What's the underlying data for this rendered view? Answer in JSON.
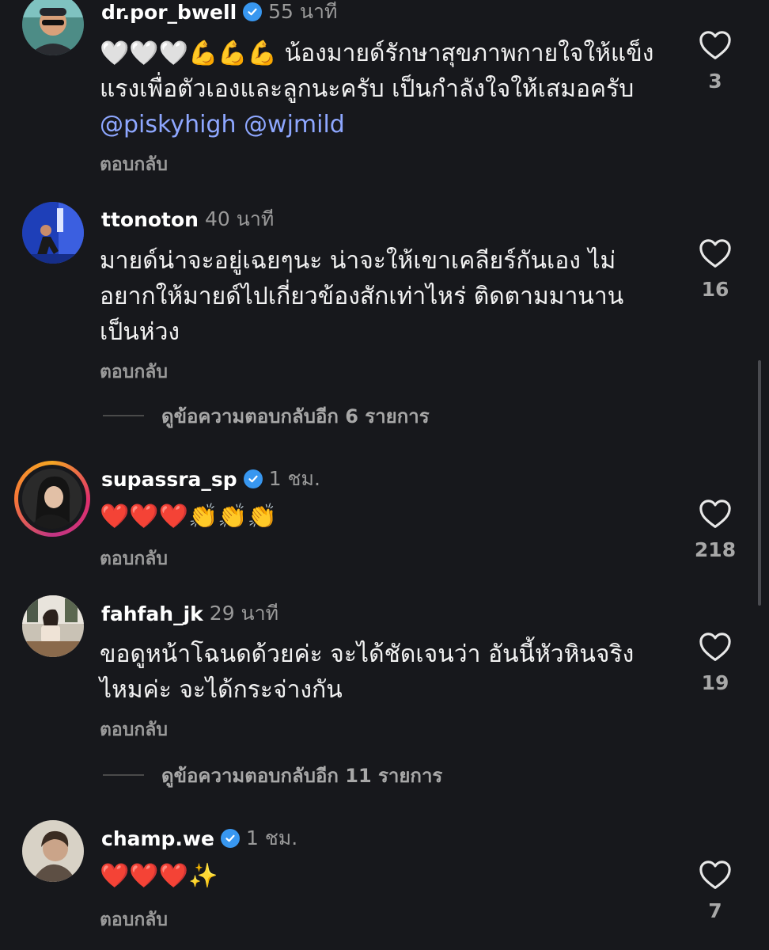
{
  "comments": [
    {
      "username": "dr.por_bwell",
      "verified": true,
      "time": "55 นาที",
      "emojis": "🤍🤍🤍💪💪💪",
      "text": " น้องมายด์รักษาสุขภาพกายใจให้แข็งแรงเพื่อตัวเองและลูกนะครับ เป็นกำลังใจให้เสมอครับ ",
      "mentions": [
        "@piskyhigh",
        "@wjmild"
      ],
      "reply_label": "ตอบกลับ",
      "likes": "3"
    },
    {
      "username": "ttonoton",
      "verified": false,
      "time": "40 นาที",
      "text": "มายด์น่าจะอยู่เฉยๆนะ  น่าจะให้เขาเคลียร์กันเอง ไม่อยากให้มายด์ไปเกี่ยวข้องสักเท่าไหร่  ติดตามมานาน เป็นห่วง",
      "reply_label": "ตอบกลับ",
      "likes": "16",
      "view_more": "ดูข้อความตอบกลับอีก 6 รายการ"
    },
    {
      "username": "supassra_sp",
      "verified": true,
      "time": "1 ชม.",
      "emojis": "❤️❤️❤️👏👏👏",
      "reply_label": "ตอบกลับ",
      "likes": "218"
    },
    {
      "username": "fahfah_jk",
      "verified": false,
      "time": "29 นาที",
      "text": "ขอดูหน้าโฉนดด้วยค่ะ จะได้ชัดเจนว่า อันนี้หัวหินจริงไหมค่ะ  จะได้กระจ่างกัน",
      "reply_label": "ตอบกลับ",
      "likes": "19",
      "view_more": "ดูข้อความตอบกลับอีก 11 รายการ"
    },
    {
      "username": "champ.we",
      "verified": true,
      "time": "1 ชม.",
      "emojis": "❤️❤️❤️✨",
      "reply_label": "ตอบกลับ",
      "likes": "7"
    }
  ],
  "icons": {
    "like": "heart-outline-icon",
    "verified": "verified-badge-icon"
  },
  "colors": {
    "background": "#17181c",
    "mention": "#8ea7ff",
    "verified": "#3897f0",
    "muted": "#9a9a9a"
  }
}
